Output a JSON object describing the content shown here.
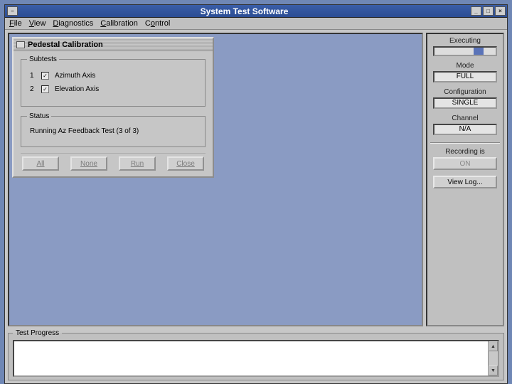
{
  "window": {
    "title": "System Test Software"
  },
  "menu": {
    "file": "File",
    "view": "View",
    "diag": "Diagnostics",
    "calib": "Calibration",
    "control": "Control"
  },
  "dialog": {
    "title": "Pedestal Calibration",
    "subtests_legend": "Subtests",
    "subtests": [
      {
        "num": "1",
        "label": "Azimuth Axis",
        "checked": true
      },
      {
        "num": "2",
        "label": "Elevation Axis",
        "checked": true
      }
    ],
    "status_legend": "Status",
    "status_text": "Running Az Feedback Test (3 of 3)",
    "buttons": {
      "all": "All",
      "none": "None",
      "run": "Run",
      "close": "Close"
    }
  },
  "right": {
    "executing_label": "Executing",
    "mode_label": "Mode",
    "mode_value": "FULL",
    "config_label": "Configuration",
    "config_value": "SINGLE",
    "channel_label": "Channel",
    "channel_value": "N/A",
    "recording_label": "Recording is",
    "recording_value": "ON",
    "view_log": "View Log..."
  },
  "progress_legend": "Test Progress"
}
